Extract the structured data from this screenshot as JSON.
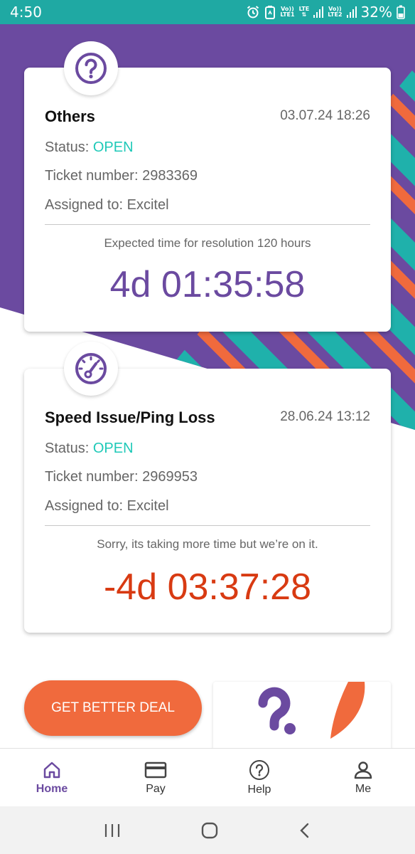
{
  "status_bar": {
    "time": "4:50",
    "battery": "32%",
    "sim1": {
      "top": "Vo))",
      "bottom": "LTE1"
    },
    "sim2_lte": "LTE",
    "sim2": {
      "top": "Vo))",
      "bottom": "LTE2"
    }
  },
  "tickets": [
    {
      "category": "Others",
      "date": "03.07.24 18:26",
      "status_label": "Status:",
      "status": "OPEN",
      "ticket_label": "Ticket number:",
      "ticket_number": "2983369",
      "assigned_label": "Assigned to:",
      "assigned_to": "Excitel",
      "note": "Expected time for resolution 120 hours",
      "timer": "4d 01:35:58",
      "timer_color": "#6b4aa0",
      "icon": "question-circle-icon"
    },
    {
      "category": "Speed Issue/Ping Loss",
      "date": "28.06.24 13:12",
      "status_label": "Status:",
      "status": "OPEN",
      "ticket_label": "Ticket number:",
      "ticket_number": "2969953",
      "assigned_label": "Assigned to:",
      "assigned_to": "Excitel",
      "note": "Sorry, its taking more time but we’re on it.",
      "timer": "-4d 03:37:28",
      "timer_color": "#d83a12",
      "icon": "speedometer-icon"
    }
  ],
  "cta": {
    "label": "GET BETTER DEAL"
  },
  "nav": [
    {
      "label": "Home",
      "icon": "home-icon",
      "active": true
    },
    {
      "label": "Pay",
      "icon": "card-icon",
      "active": false
    },
    {
      "label": "Help",
      "icon": "help-icon",
      "active": false
    },
    {
      "label": "Me",
      "icon": "person-icon",
      "active": false
    }
  ],
  "colors": {
    "brand_purple": "#6b4aa0",
    "teal": "#1fa9a3",
    "orange": "#f06a3d",
    "status_open": "#1fc9b8",
    "overdue_red": "#d83a12"
  }
}
